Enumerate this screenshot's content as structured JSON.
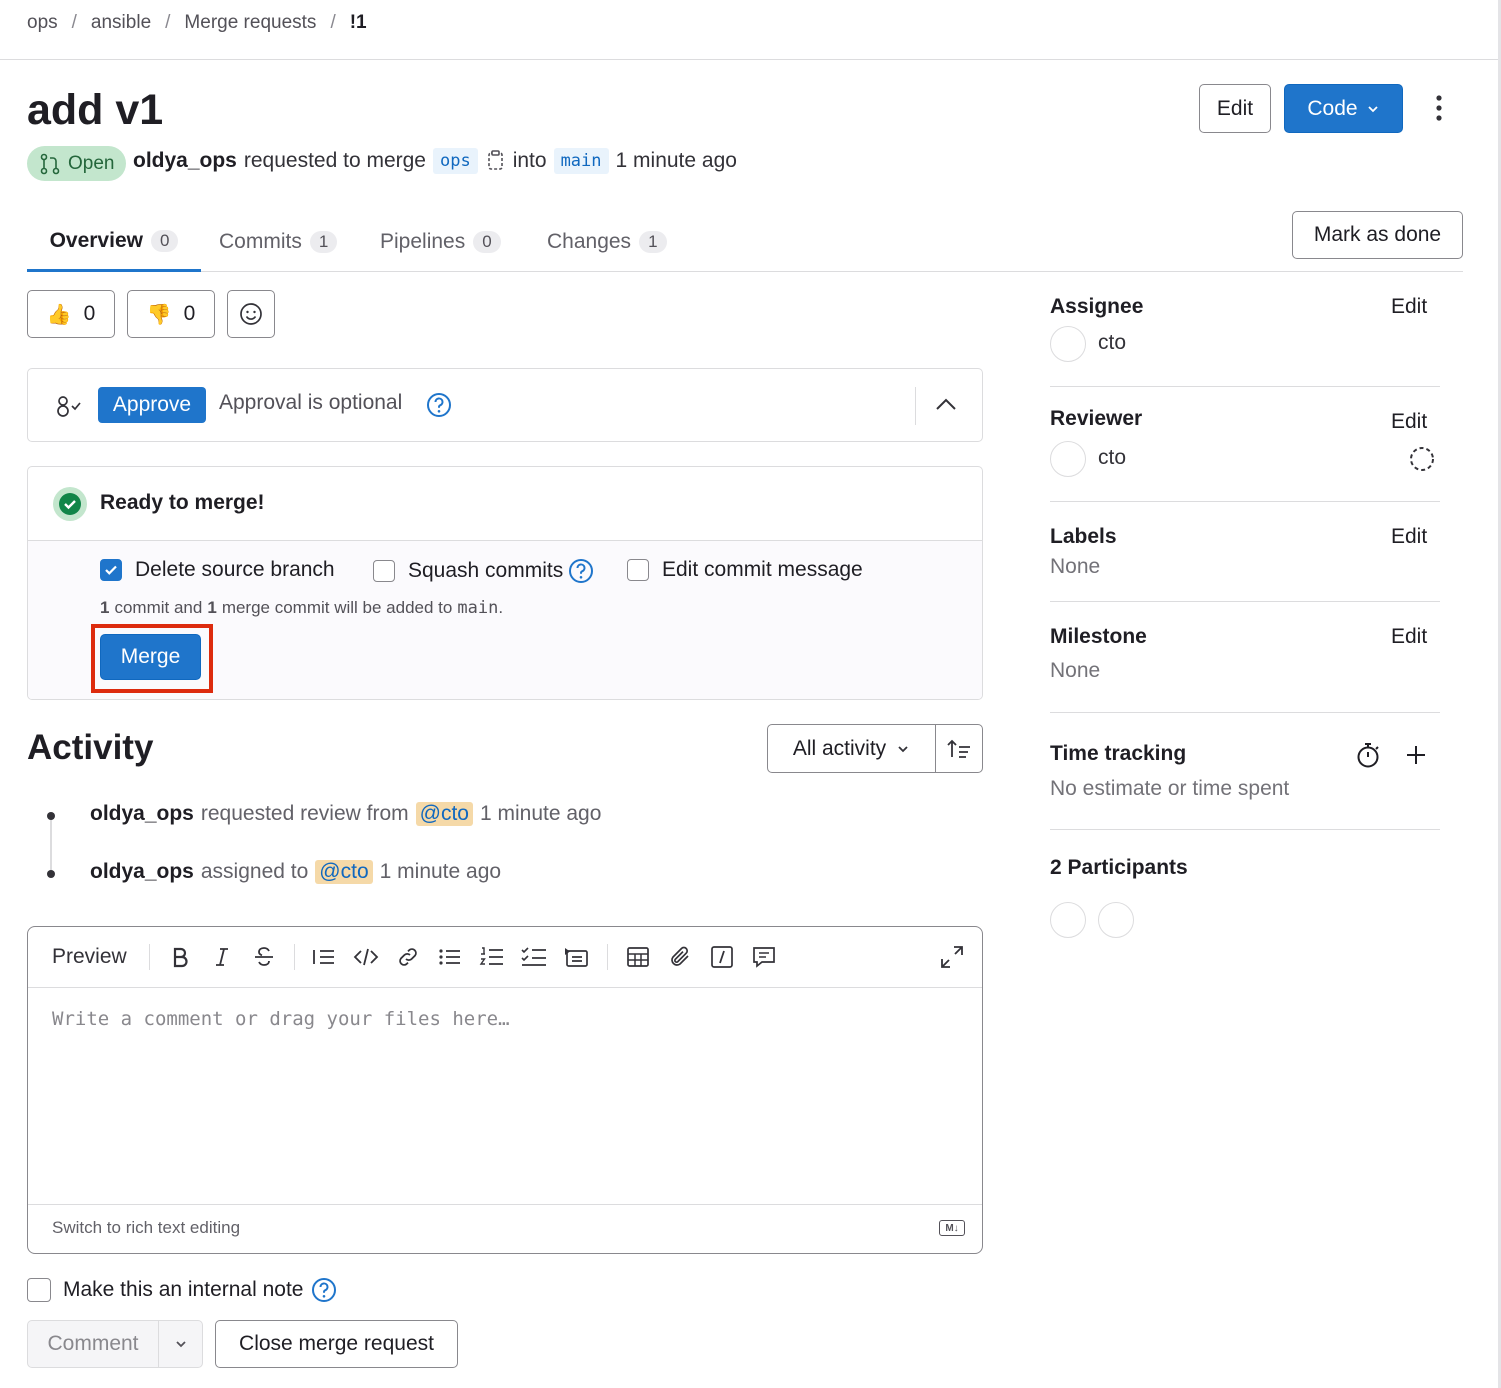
{
  "breadcrumb": {
    "items": [
      "ops",
      "ansible",
      "Merge requests",
      "!1"
    ],
    "separator": "/"
  },
  "header": {
    "title": "add v1",
    "edit_label": "Edit",
    "code_label": "Code",
    "status": "Open",
    "author": "oldya_ops",
    "requested_text": "requested to merge",
    "source_branch": "ops",
    "into_text": "into",
    "target_branch": "main",
    "time": "1 minute ago"
  },
  "tabs": [
    {
      "label": "Overview",
      "count": "0"
    },
    {
      "label": "Commits",
      "count": "1"
    },
    {
      "label": "Pipelines",
      "count": "0"
    },
    {
      "label": "Changes",
      "count": "1"
    }
  ],
  "mark_done_label": "Mark as done",
  "reactions": {
    "thumbs_up": "0",
    "thumbs_down": "0"
  },
  "approval": {
    "approve_label": "Approve",
    "text": "Approval is optional"
  },
  "merge": {
    "status": "Ready to merge!",
    "delete_source": "Delete source branch",
    "squash": "Squash commits",
    "edit_message": "Edit commit message",
    "info_n1": "1",
    "info_t1": "commit and",
    "info_n2": "1",
    "info_t2": "merge commit will be added to",
    "info_branch": "main",
    "info_end": ".",
    "button": "Merge"
  },
  "activity": {
    "title": "Activity",
    "filter": "All activity",
    "items": [
      {
        "user": "oldya_ops",
        "action": "requested review from",
        "mention": "@cto",
        "time": "1 minute ago"
      },
      {
        "user": "oldya_ops",
        "action": "assigned to",
        "mention": "@cto",
        "time": "1 minute ago"
      }
    ]
  },
  "editor": {
    "preview": "Preview",
    "placeholder": "Write a comment or drag your files here…",
    "switch_rich": "Switch to rich text editing",
    "md_badge": "M↓"
  },
  "internal_note": "Make this an internal note",
  "comment_label": "Comment",
  "close_label": "Close merge request",
  "sidebar": {
    "assignee": {
      "heading": "Assignee",
      "edit": "Edit",
      "value": "cto"
    },
    "reviewer": {
      "heading": "Reviewer",
      "edit": "Edit",
      "value": "cto"
    },
    "labels": {
      "heading": "Labels",
      "edit": "Edit",
      "value": "None"
    },
    "milestone": {
      "heading": "Milestone",
      "edit": "Edit",
      "value": "None"
    },
    "time_tracking": {
      "heading": "Time tracking",
      "value": "No estimate or time spent"
    },
    "participants": "2 Participants"
  },
  "colors": {
    "primary": "#1f75cb",
    "success": "#108548",
    "highlight": "#dd2b0e"
  }
}
